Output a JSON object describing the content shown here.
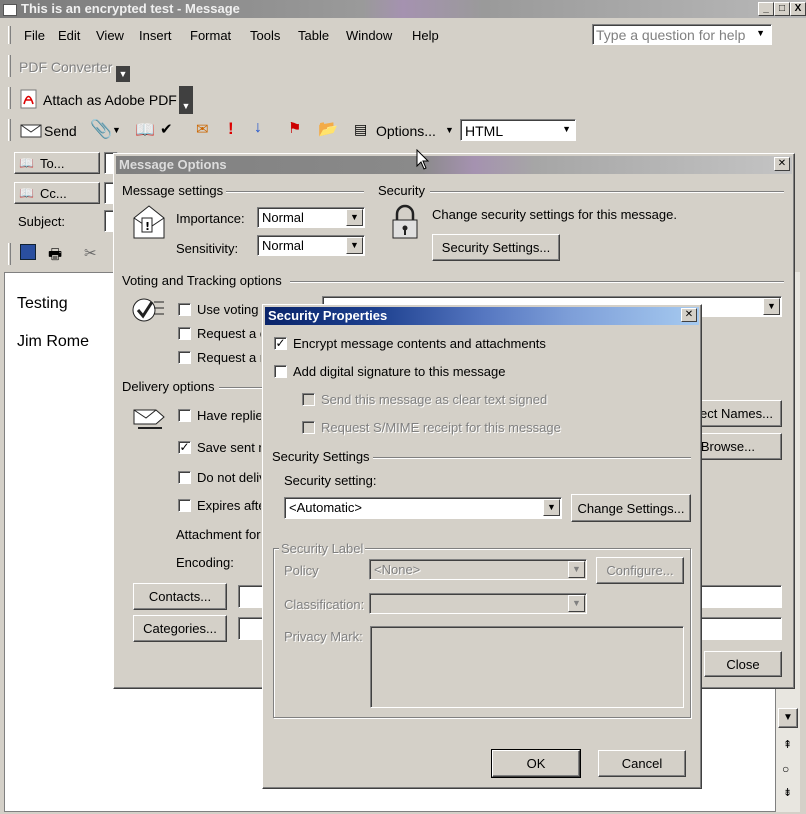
{
  "window": {
    "title": "This is an encrypted test - Message",
    "controls": [
      "_",
      "□",
      "X"
    ]
  },
  "menu": {
    "items": [
      "File",
      "Edit",
      "View",
      "Insert",
      "Format",
      "Tools",
      "Table",
      "Window",
      "Help"
    ],
    "help_placeholder": "Type a question for help"
  },
  "toolbars": {
    "pdf_converter": "PDF Converter",
    "attach_adobe": "Attach as Adobe PDF",
    "send": "Send",
    "options": "Options...",
    "format_value": "HTML"
  },
  "header_fields": {
    "to": "To...",
    "cc": "Cc...",
    "subject": "Subject:"
  },
  "body": {
    "line1": "Testing",
    "line2": "Jim Rome"
  },
  "message_options": {
    "title": "Message Options",
    "message_settings": "Message settings",
    "importance_label": "Importance:",
    "importance_value": "Normal",
    "sensitivity_label": "Sensitivity:",
    "sensitivity_value": "Normal",
    "security": "Security",
    "security_desc": "Change security settings for this message.",
    "security_settings_btn": "Security Settings...",
    "voting": "Voting and Tracking options",
    "use_voting": "Use voting b",
    "request_a": "Request a d",
    "request_r": "Request a r",
    "delivery": "Delivery options",
    "have_replies": "Have replie",
    "save_sent": "Save sent m",
    "do_not_deliver": "Do not deliv",
    "expires": "Expires afte",
    "attachment_format": "Attachment for",
    "encoding": "Encoding:",
    "select_names": "ect Names...",
    "browse": "Browse...",
    "contacts": "Contacts...",
    "categories": "Categories...",
    "close": "Close"
  },
  "security_properties": {
    "title": "Security Properties",
    "encrypt": "Encrypt message contents and attachments",
    "encrypt_checked": true,
    "add_signature": "Add digital signature to this message",
    "add_signature_checked": false,
    "send_clear": "Send this message as clear text signed",
    "request_smime": "Request S/MIME receipt for this message",
    "security_settings_group": "Security Settings",
    "security_setting_label": "Security setting:",
    "security_setting_value": "<Automatic>",
    "change_settings": "Change Settings...",
    "security_label_group": "Security Label",
    "policy": "Policy",
    "policy_value": "<None>",
    "configure": "Configure...",
    "classification": "Classification:",
    "privacy_mark": "Privacy Mark:",
    "ok": "OK",
    "cancel": "Cancel"
  }
}
